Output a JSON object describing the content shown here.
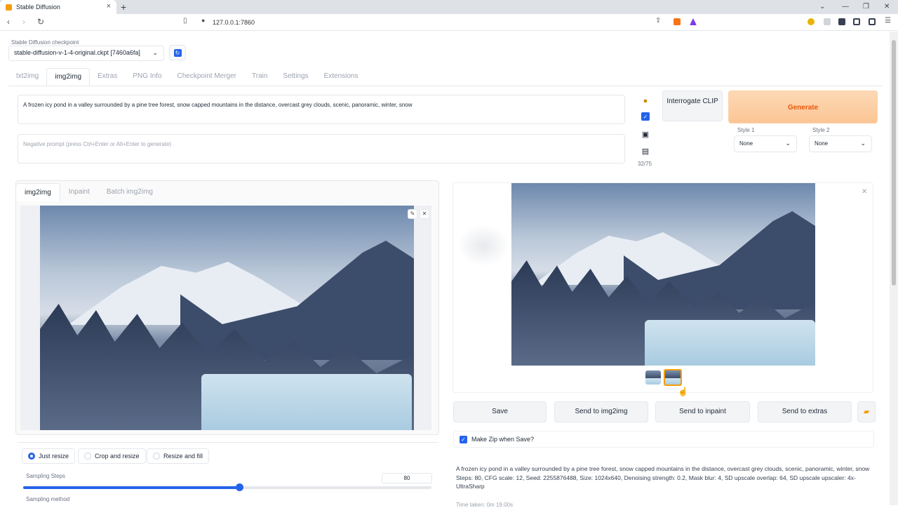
{
  "browser": {
    "tab_title": "Stable Diffusion",
    "url": "127.0.0.1:7860"
  },
  "checkpoint": {
    "label": "Stable Diffusion checkpoint",
    "value": "stable-diffusion-v-1-4-original.ckpt [7460a6fa]"
  },
  "tabs": [
    "txt2img",
    "img2img",
    "Extras",
    "PNG Info",
    "Checkpoint Merger",
    "Train",
    "Settings",
    "Extensions"
  ],
  "active_tab": "img2img",
  "prompt": {
    "positive": "A frozen icy pond in a valley surrounded by a pine tree forest, snow capped mountains in the distance, overcast grey clouds, scenic, panoramic, winter, snow",
    "negative_placeholder": "Negative prompt (press Ctrl+Enter or Alt+Enter to generate)",
    "token_count": "32/75"
  },
  "buttons": {
    "interrogate": "Interrogate CLIP",
    "generate": "Generate"
  },
  "styles": {
    "style1_label": "Style 1",
    "style1_value": "None",
    "style2_label": "Style 2",
    "style2_value": "None"
  },
  "subtabs": [
    "img2img",
    "Inpaint",
    "Batch img2img"
  ],
  "resize_modes": [
    "Just resize",
    "Crop and resize",
    "Resize and fill"
  ],
  "selected_resize": "Just resize",
  "sampling_steps": {
    "label": "Sampling Steps",
    "value": "80",
    "fraction": 0.53
  },
  "sampling_method_label": "Sampling method",
  "output_actions": [
    "Save",
    "Send to img2img",
    "Send to inpaint",
    "Send to extras"
  ],
  "make_zip": {
    "label": "Make Zip when Save?",
    "checked": true
  },
  "output_info": {
    "prompt": "A frozen icy pond in a valley surrounded by a pine tree forest, snow capped mountains in the distance, overcast grey clouds, scenic, panoramic, winter, snow",
    "params": "Steps: 80, CFG scale: 12, Seed: 2255876488, Size: 1024x640, Denoising strength: 0.2, Mask blur: 4, SD upscale overlap: 64, SD upscale upscaler: 4x-UltraSharp",
    "time": "Time taken: 0m 19.00s"
  },
  "icons": {
    "paint": "palette-icon",
    "check": "checkbox-icon",
    "save": "save-icon",
    "clipboard": "clipboard-icon",
    "folder": "folder-icon"
  }
}
